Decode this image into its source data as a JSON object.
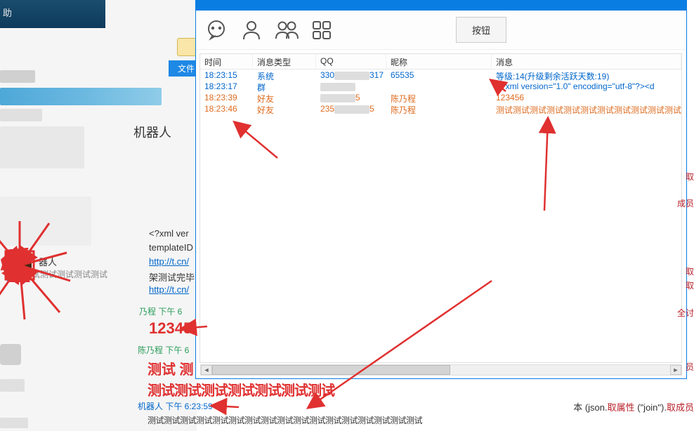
{
  "bg": {
    "help_partial": "助"
  },
  "file_tab": {
    "label": "文件"
  },
  "robot": {
    "title": "机器人",
    "name": "器人",
    "sub": "试测试测试测试测试"
  },
  "chat": {
    "xml_partial": "<?xml ver",
    "tmpl_partial": "templateID",
    "link1": "http://t.cn/",
    "arch_partial": "架测试完毕",
    "link2": "http://t.cn/",
    "time1": "乃程 下午 6",
    "big_num": "12345",
    "time2": "陈乃程 下午 6",
    "test_line1": "测试 测",
    "test_line2": "测试测试测试测试测试测试测试",
    "time3": "机器人 下午 6:23:59",
    "long_test": "测试测试测试测试测试测试测试测试测试测试测试测试测试测试测试测试测试"
  },
  "window": {
    "button_label": "按钮",
    "columns": {
      "time": "时间",
      "type": "消息类型",
      "qq": "QQ",
      "nick": "昵称",
      "msg": "消息"
    },
    "rows": [
      {
        "time": "18:23:15",
        "type": "系统",
        "qq_a": "330",
        "qq_b": "317",
        "nick": "65535",
        "msg": "等级:14(升级剩余活跃天数:19)",
        "cls": "row-blue",
        "blur": true
      },
      {
        "time": "18:23:17",
        "type": "群",
        "qq_a": "",
        "qq_b": "",
        "nick": "",
        "msg": "<?xml version=\"1.0\" encoding=\"utf-8\"?><d",
        "cls": "row-blue",
        "blur": true
      },
      {
        "time": "18:23:39",
        "type": "好友",
        "qq_a": "",
        "qq_b": "5",
        "nick": "陈乃程",
        "msg": "123456",
        "cls": "row-orange",
        "blur": true
      },
      {
        "time": "18:23:46",
        "type": "好友",
        "qq_a": "235",
        "qq_b": "5",
        "nick": "陈乃程",
        "msg": "测试测试测试测试测试测试测试测试测试测试测试测",
        "cls": "row-orange",
        "blur": true
      }
    ]
  },
  "edge": {
    "t1": "取",
    "t2": "成员",
    "t3": "取",
    "t4": "取",
    "t5": "全讨",
    "t6": "员",
    "code_pre": "本 (json.",
    "code_method": "取属性",
    "code_arg": " (\"join\").",
    "code_after": "取成员"
  }
}
